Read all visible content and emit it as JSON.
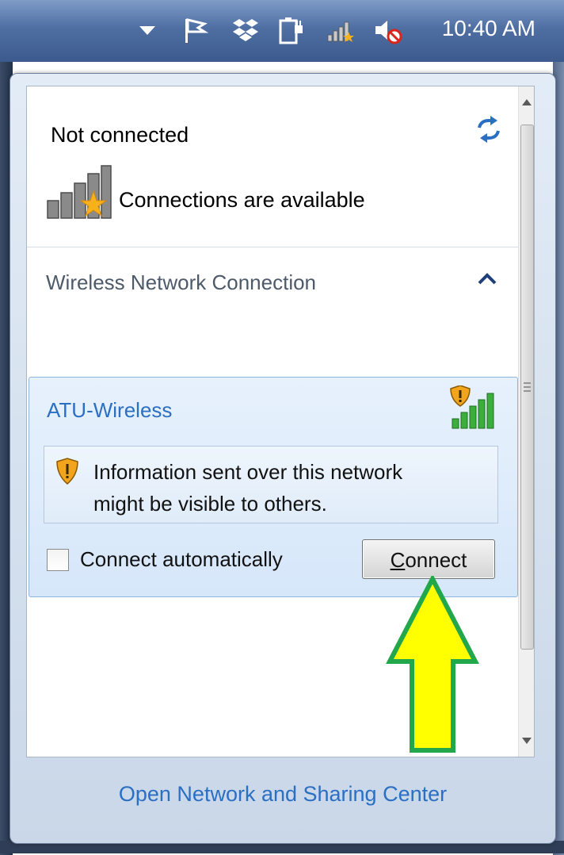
{
  "taskbar": {
    "clock": "10:40 AM",
    "icons": [
      "show-hidden-icons-icon",
      "action-center-flag-icon",
      "dropbox-icon",
      "power-icon",
      "network-icon",
      "volume-muted-icon"
    ]
  },
  "flyout": {
    "status_title": "Not connected",
    "availability": "Connections are available",
    "section_label": "Wireless Network Connection",
    "network": {
      "name": "ATU-Wireless",
      "warning": "Information sent over this network might be visible to others.",
      "warning_line1": "Information sent over this network",
      "warning_line2": "might be visible to others.",
      "auto_connect_label": "Connect automatically",
      "auto_connect_checked": false,
      "connect_button_mnemonic": "C",
      "connect_button_rest": "onnect"
    },
    "footer_link": "Open Network and Sharing Center"
  },
  "colors": {
    "link": "#2b6fc2",
    "arrow_fill": "#ffff00",
    "arrow_stroke": "#22a84a",
    "selected_card": "#d6e7fa"
  }
}
